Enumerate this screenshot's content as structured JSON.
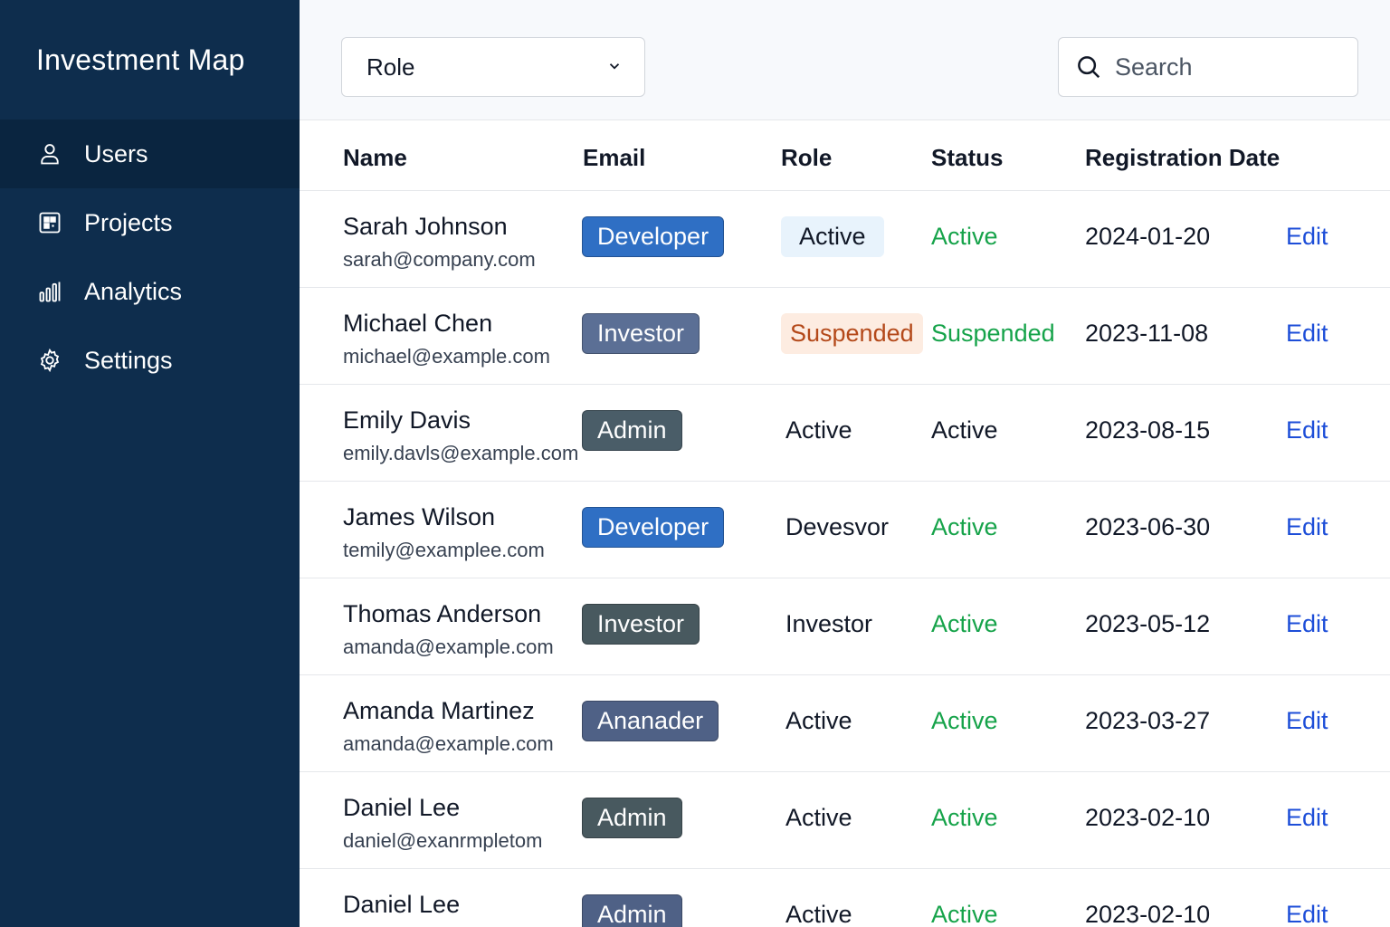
{
  "app": {
    "title": "Investment Map"
  },
  "sidebar": {
    "items": [
      {
        "label": "Users",
        "icon": "user-icon",
        "active": true
      },
      {
        "label": "Projects",
        "icon": "grid-icon",
        "active": false
      },
      {
        "label": "Analytics",
        "icon": "bar-chart-icon",
        "active": false
      },
      {
        "label": "Settings",
        "icon": "gear-icon",
        "active": false
      }
    ]
  },
  "toolbar": {
    "role_filter": {
      "value": "Role",
      "icon": "chevron-down-icon"
    },
    "search": {
      "placeholder": "Search",
      "icon": "search-icon"
    }
  },
  "table": {
    "headers": [
      "Name",
      "Email",
      "Role",
      "Status",
      "Registration Date"
    ],
    "edit_label": "Edit",
    "rows": [
      {
        "name": "Sarah Johnson",
        "email": "sarah@company.com",
        "badge": "Developer",
        "badge_color": "#2f6fc4",
        "role": "Active",
        "role_style": "pill-blue",
        "status": "Active",
        "status_color": "#16a34a",
        "date": "2024-01-20"
      },
      {
        "name": "Michael Chen",
        "email": "michael@example.com",
        "badge": "Investor",
        "badge_color": "#5b6f95",
        "role": "Suspended",
        "role_style": "pill-orange",
        "status": "Suspended",
        "status_color": "#16a34a",
        "date": "2023-11-08"
      },
      {
        "name": "Emily Davis",
        "email": "emily.davls@example.com",
        "badge": "Admin",
        "badge_color": "#4a5d68",
        "role": "Active",
        "role_style": "plain",
        "status": "Active",
        "status_color": "#111827",
        "date": "2023-08-15"
      },
      {
        "name": "James Wilson",
        "email": "temily@examplee.com",
        "badge": "Developer",
        "badge_color": "#2f6fc4",
        "role": "Devesvor",
        "role_style": "plain",
        "status": "Active",
        "status_color": "#16a34a",
        "date": "2023-06-30"
      },
      {
        "name": "Thomas Anderson",
        "email": "amanda@example.com",
        "badge": "Investor",
        "badge_color": "#48595f",
        "role": "Investor",
        "role_style": "plain",
        "status": "Active",
        "status_color": "#16a34a",
        "date": "2023-05-12"
      },
      {
        "name": "Amanda Martinez",
        "email": "amanda@example.com",
        "badge": "Ananader",
        "badge_color": "#4f6186",
        "role": "Active",
        "role_style": "plain",
        "status": "Active",
        "status_color": "#16a34a",
        "date": "2023-03-27"
      },
      {
        "name": "Daniel Lee",
        "email": "daniel@exanrmpletom",
        "badge": "Admin",
        "badge_color": "#48595f",
        "role": "Active",
        "role_style": "plain",
        "status": "Active",
        "status_color": "#16a34a",
        "date": "2023-02-10"
      },
      {
        "name": "Daniel Lee",
        "email": "",
        "badge": "Admin",
        "badge_color": "#4f6186",
        "role": "Active",
        "role_style": "plain",
        "status": "Active",
        "status_color": "#16a34a",
        "date": "2023-02-10"
      }
    ]
  }
}
